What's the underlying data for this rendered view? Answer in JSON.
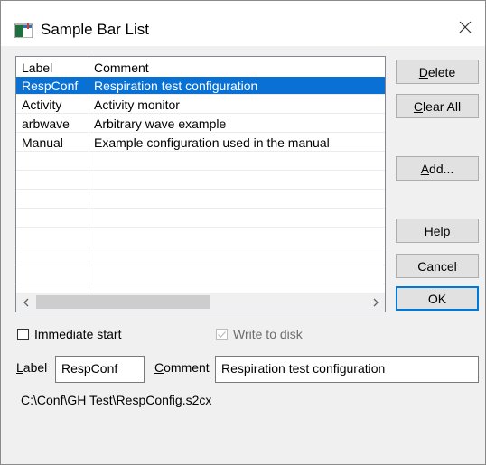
{
  "window": {
    "title": "Sample Bar List",
    "close_icon": "close-icon"
  },
  "list": {
    "columns": [
      "Label",
      "Comment"
    ],
    "rows": [
      {
        "label": "RespConf",
        "comment": "Respiration test configuration",
        "selected": true
      },
      {
        "label": "Activity",
        "comment": "Activity monitor",
        "selected": false
      },
      {
        "label": "arbwave",
        "comment": "Arbitrary wave example",
        "selected": false
      },
      {
        "label": "Manual",
        "comment": "Example configuration used in the manual",
        "selected": false
      }
    ]
  },
  "buttons": {
    "delete": {
      "pre": "",
      "key": "D",
      "post": "elete"
    },
    "clear_all": {
      "pre": "",
      "key": "C",
      "post": "lear All"
    },
    "add": {
      "pre": "",
      "key": "A",
      "post": "dd..."
    },
    "help": {
      "pre": "",
      "key": "H",
      "post": "elp"
    },
    "cancel": "Cancel",
    "ok": "OK"
  },
  "options": {
    "immediate_start": {
      "label": "Immediate start",
      "checked": false
    },
    "write_to_disk": {
      "label": "Write to disk",
      "checked": true,
      "disabled": true
    }
  },
  "fields": {
    "label": {
      "pre": "",
      "key": "L",
      "post": "abel",
      "value": "RespConf"
    },
    "comment": {
      "pre": "",
      "key": "C",
      "post": "omment",
      "value": "Respiration test configuration"
    }
  },
  "path": "C:\\Conf\\GH Test\\RespConfig.s2cx",
  "colors": {
    "selection": "#0a71d4",
    "default_button_border": "#0078d7"
  }
}
